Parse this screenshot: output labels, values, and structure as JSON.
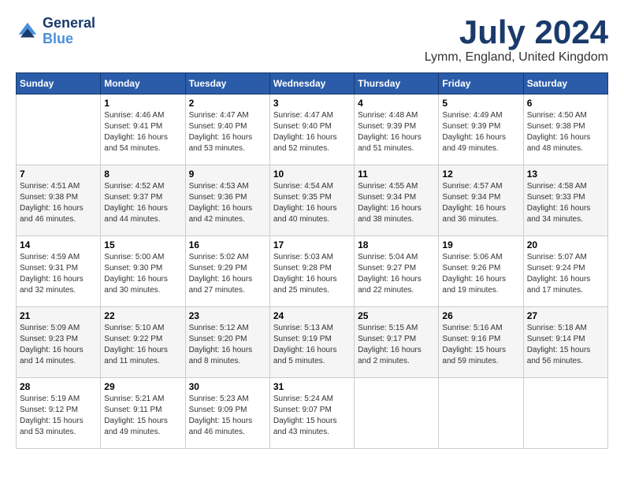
{
  "header": {
    "logo_line1": "General",
    "logo_line2": "Blue",
    "month_year": "July 2024",
    "location": "Lymm, England, United Kingdom"
  },
  "calendar": {
    "days_of_week": [
      "Sunday",
      "Monday",
      "Tuesday",
      "Wednesday",
      "Thursday",
      "Friday",
      "Saturday"
    ],
    "weeks": [
      [
        {
          "day": "",
          "info": ""
        },
        {
          "day": "1",
          "info": "Sunrise: 4:46 AM\nSunset: 9:41 PM\nDaylight: 16 hours\nand 54 minutes."
        },
        {
          "day": "2",
          "info": "Sunrise: 4:47 AM\nSunset: 9:40 PM\nDaylight: 16 hours\nand 53 minutes."
        },
        {
          "day": "3",
          "info": "Sunrise: 4:47 AM\nSunset: 9:40 PM\nDaylight: 16 hours\nand 52 minutes."
        },
        {
          "day": "4",
          "info": "Sunrise: 4:48 AM\nSunset: 9:39 PM\nDaylight: 16 hours\nand 51 minutes."
        },
        {
          "day": "5",
          "info": "Sunrise: 4:49 AM\nSunset: 9:39 PM\nDaylight: 16 hours\nand 49 minutes."
        },
        {
          "day": "6",
          "info": "Sunrise: 4:50 AM\nSunset: 9:38 PM\nDaylight: 16 hours\nand 48 minutes."
        }
      ],
      [
        {
          "day": "7",
          "info": "Sunrise: 4:51 AM\nSunset: 9:38 PM\nDaylight: 16 hours\nand 46 minutes."
        },
        {
          "day": "8",
          "info": "Sunrise: 4:52 AM\nSunset: 9:37 PM\nDaylight: 16 hours\nand 44 minutes."
        },
        {
          "day": "9",
          "info": "Sunrise: 4:53 AM\nSunset: 9:36 PM\nDaylight: 16 hours\nand 42 minutes."
        },
        {
          "day": "10",
          "info": "Sunrise: 4:54 AM\nSunset: 9:35 PM\nDaylight: 16 hours\nand 40 minutes."
        },
        {
          "day": "11",
          "info": "Sunrise: 4:55 AM\nSunset: 9:34 PM\nDaylight: 16 hours\nand 38 minutes."
        },
        {
          "day": "12",
          "info": "Sunrise: 4:57 AM\nSunset: 9:34 PM\nDaylight: 16 hours\nand 36 minutes."
        },
        {
          "day": "13",
          "info": "Sunrise: 4:58 AM\nSunset: 9:33 PM\nDaylight: 16 hours\nand 34 minutes."
        }
      ],
      [
        {
          "day": "14",
          "info": "Sunrise: 4:59 AM\nSunset: 9:31 PM\nDaylight: 16 hours\nand 32 minutes."
        },
        {
          "day": "15",
          "info": "Sunrise: 5:00 AM\nSunset: 9:30 PM\nDaylight: 16 hours\nand 30 minutes."
        },
        {
          "day": "16",
          "info": "Sunrise: 5:02 AM\nSunset: 9:29 PM\nDaylight: 16 hours\nand 27 minutes."
        },
        {
          "day": "17",
          "info": "Sunrise: 5:03 AM\nSunset: 9:28 PM\nDaylight: 16 hours\nand 25 minutes."
        },
        {
          "day": "18",
          "info": "Sunrise: 5:04 AM\nSunset: 9:27 PM\nDaylight: 16 hours\nand 22 minutes."
        },
        {
          "day": "19",
          "info": "Sunrise: 5:06 AM\nSunset: 9:26 PM\nDaylight: 16 hours\nand 19 minutes."
        },
        {
          "day": "20",
          "info": "Sunrise: 5:07 AM\nSunset: 9:24 PM\nDaylight: 16 hours\nand 17 minutes."
        }
      ],
      [
        {
          "day": "21",
          "info": "Sunrise: 5:09 AM\nSunset: 9:23 PM\nDaylight: 16 hours\nand 14 minutes."
        },
        {
          "day": "22",
          "info": "Sunrise: 5:10 AM\nSunset: 9:22 PM\nDaylight: 16 hours\nand 11 minutes."
        },
        {
          "day": "23",
          "info": "Sunrise: 5:12 AM\nSunset: 9:20 PM\nDaylight: 16 hours\nand 8 minutes."
        },
        {
          "day": "24",
          "info": "Sunrise: 5:13 AM\nSunset: 9:19 PM\nDaylight: 16 hours\nand 5 minutes."
        },
        {
          "day": "25",
          "info": "Sunrise: 5:15 AM\nSunset: 9:17 PM\nDaylight: 16 hours\nand 2 minutes."
        },
        {
          "day": "26",
          "info": "Sunrise: 5:16 AM\nSunset: 9:16 PM\nDaylight: 15 hours\nand 59 minutes."
        },
        {
          "day": "27",
          "info": "Sunrise: 5:18 AM\nSunset: 9:14 PM\nDaylight: 15 hours\nand 56 minutes."
        }
      ],
      [
        {
          "day": "28",
          "info": "Sunrise: 5:19 AM\nSunset: 9:12 PM\nDaylight: 15 hours\nand 53 minutes."
        },
        {
          "day": "29",
          "info": "Sunrise: 5:21 AM\nSunset: 9:11 PM\nDaylight: 15 hours\nand 49 minutes."
        },
        {
          "day": "30",
          "info": "Sunrise: 5:23 AM\nSunset: 9:09 PM\nDaylight: 15 hours\nand 46 minutes."
        },
        {
          "day": "31",
          "info": "Sunrise: 5:24 AM\nSunset: 9:07 PM\nDaylight: 15 hours\nand 43 minutes."
        },
        {
          "day": "",
          "info": ""
        },
        {
          "day": "",
          "info": ""
        },
        {
          "day": "",
          "info": ""
        }
      ]
    ]
  }
}
